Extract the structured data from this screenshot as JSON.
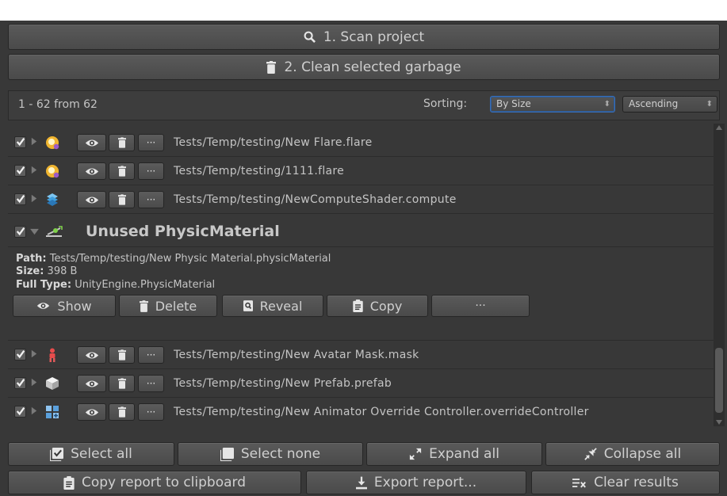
{
  "actions": {
    "scan_label": "1. Scan project",
    "clean_label": "2. Clean selected garbage"
  },
  "results_header": {
    "count_text": "1 - 62 from 62",
    "sorting_label": "Sorting:",
    "sort_by": "By Size",
    "sort_order": "Ascending"
  },
  "items": [
    {
      "path": "Tests/Temp/testing/New Flare.flare",
      "icon": "flare-icon",
      "checked": true
    },
    {
      "path": "Tests/Temp/testing/1111.flare",
      "icon": "flare-icon",
      "checked": true
    },
    {
      "path": "Tests/Temp/testing/NewComputeShader.compute",
      "icon": "compute-shader-icon",
      "checked": true
    }
  ],
  "expanded_item": {
    "title": "Unused PhysicMaterial",
    "icon": "physic-material-icon",
    "checked": true,
    "path_label": "Path:",
    "path": "Tests/Temp/testing/New Physic Material.physicMaterial",
    "size_label": "Size:",
    "size": "398 B",
    "type_label": "Full Type:",
    "type": "UnityEngine.PhysicMaterial",
    "buttons": {
      "show": "Show",
      "delete": "Delete",
      "reveal": "Reveal",
      "copy": "Copy",
      "more": "···"
    }
  },
  "items_after": [
    {
      "path": "Tests/Temp/testing/New Avatar Mask.mask",
      "icon": "avatar-mask-icon",
      "checked": true
    },
    {
      "path": "Tests/Temp/testing/New Prefab.prefab",
      "icon": "prefab-icon",
      "checked": true
    },
    {
      "path": "Tests/Temp/testing/New Animator Override Controller.overrideController",
      "icon": "animator-override-icon",
      "checked": true
    }
  ],
  "row_more_label": "···",
  "footer": {
    "select_all": "Select all",
    "select_none": "Select none",
    "expand_all": "Expand all",
    "collapse_all": "Collapse all",
    "copy_report": "Copy report to clipboard",
    "export_report": "Export report...",
    "clear_results": "Clear results"
  },
  "colors": {
    "background": "#383838",
    "button": "#505050",
    "text": "#c4c4c4",
    "focus_outline": "#3a6fb8"
  }
}
